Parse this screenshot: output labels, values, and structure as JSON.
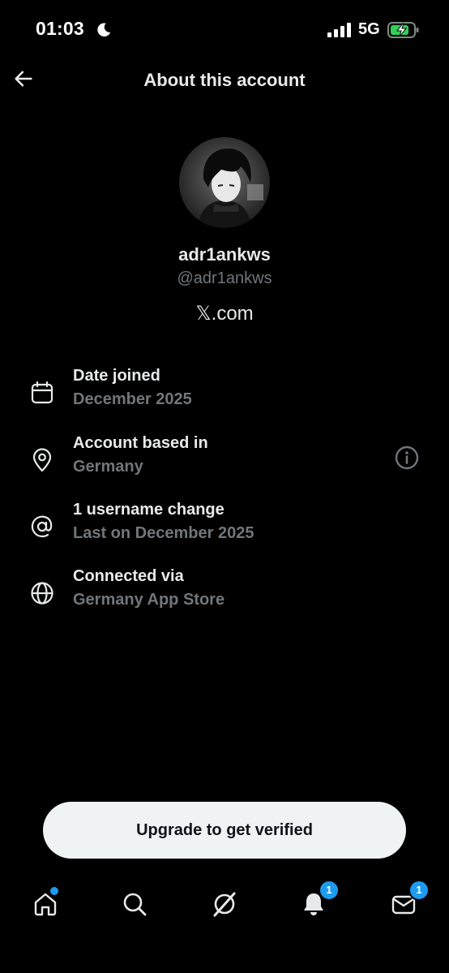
{
  "status_bar": {
    "time": "01:03",
    "network": "5G"
  },
  "header": {
    "title": "About this account"
  },
  "profile": {
    "display_name": "adr1ankws",
    "handle": "@adr1ankws",
    "platform": "𝕏.com"
  },
  "info_rows": [
    {
      "title": "Date joined",
      "subtitle": "December 2025",
      "icon": "calendar-icon"
    },
    {
      "title": "Account based in",
      "subtitle": "Germany",
      "icon": "location-pin-icon"
    },
    {
      "title": "1 username change",
      "subtitle": "Last on December 2025",
      "icon": "at-sign-icon"
    },
    {
      "title": "Connected via",
      "subtitle": "Germany App Store",
      "icon": "globe-icon"
    }
  ],
  "upgrade_label": "Upgrade to get verified",
  "nav": {
    "items": [
      "home-icon",
      "search-icon",
      "grok-icon",
      "bell-icon",
      "mail-icon"
    ],
    "notifications_badge": "1",
    "messages_badge": "1"
  },
  "colors": {
    "background": "#000000",
    "primary_text": "#e7e9ea",
    "secondary_text": "#71767b",
    "accent": "#1d9bf0",
    "button_bg": "#eff3f4"
  }
}
